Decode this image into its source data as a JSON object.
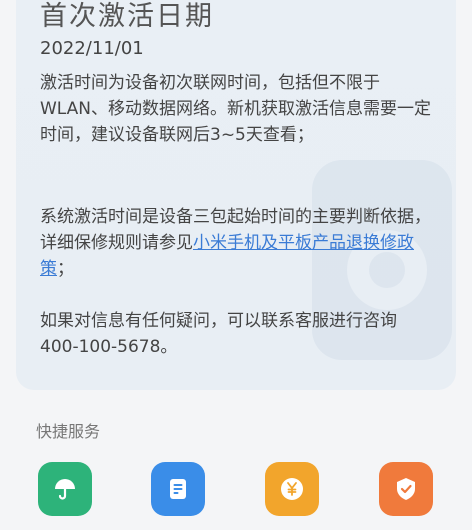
{
  "activation": {
    "title": "首次激活日期",
    "date": "2022/11/01",
    "para1": "激活时间为设备初次联网时间，包括但不限于WLAN、移动数据网络。新机获取激活信息需要一定时间，建议设备联网后3~5天查看；",
    "para2_prefix": "系统激活时间是设备三包起始时间的主要判断依据，详细保修规则请参见",
    "para2_link": "小米手机及平板产品退换修政策",
    "para2_suffix": "；",
    "para3": "如果对信息有任何疑问，可以联系客服进行咨询400-100-5678。"
  },
  "quick_services": {
    "title": "快捷服务",
    "items": [
      {
        "icon": "umbrella-icon",
        "color": "#2db37a"
      },
      {
        "icon": "document-icon",
        "color": "#3a8de8"
      },
      {
        "icon": "yen-coin-icon",
        "color": "#f2a52c"
      },
      {
        "icon": "check-badge-icon",
        "color": "#f07a3c"
      }
    ]
  }
}
